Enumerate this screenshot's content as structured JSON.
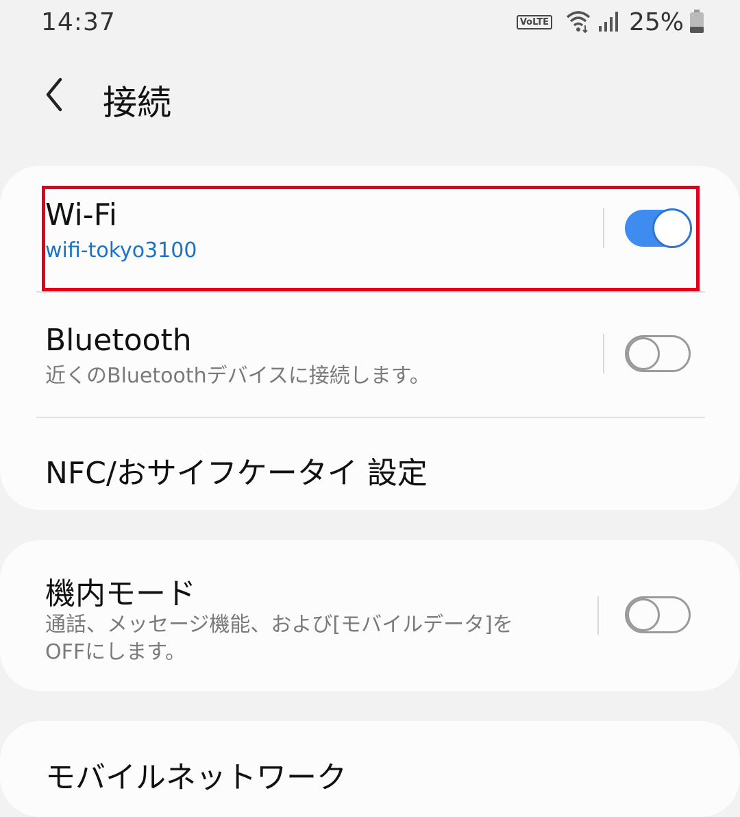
{
  "status": {
    "time": "14:37",
    "volte": "VoLTE",
    "battery": "25%"
  },
  "header": {
    "title": "接続"
  },
  "settings": {
    "wifi": {
      "title": "Wi-Fi",
      "subtitle": "wifi-tokyo3100",
      "enabled": true
    },
    "bluetooth": {
      "title": "Bluetooth",
      "subtitle": "近くのBluetoothデバイスに接続します。",
      "enabled": false
    },
    "nfc": {
      "title": "NFC/おサイフケータイ 設定"
    },
    "airplane": {
      "title": "機内モード",
      "subtitle_line1": "通話、メッセージ機能、および[モバイルデータ]を",
      "subtitle_line2": "OFFにします。",
      "enabled": false
    },
    "mobile_network": {
      "title": "モバイルネットワーク"
    }
  },
  "colors": {
    "accent": "#3e8cf0",
    "link": "#1a73c8",
    "highlight": "#e0001b"
  }
}
